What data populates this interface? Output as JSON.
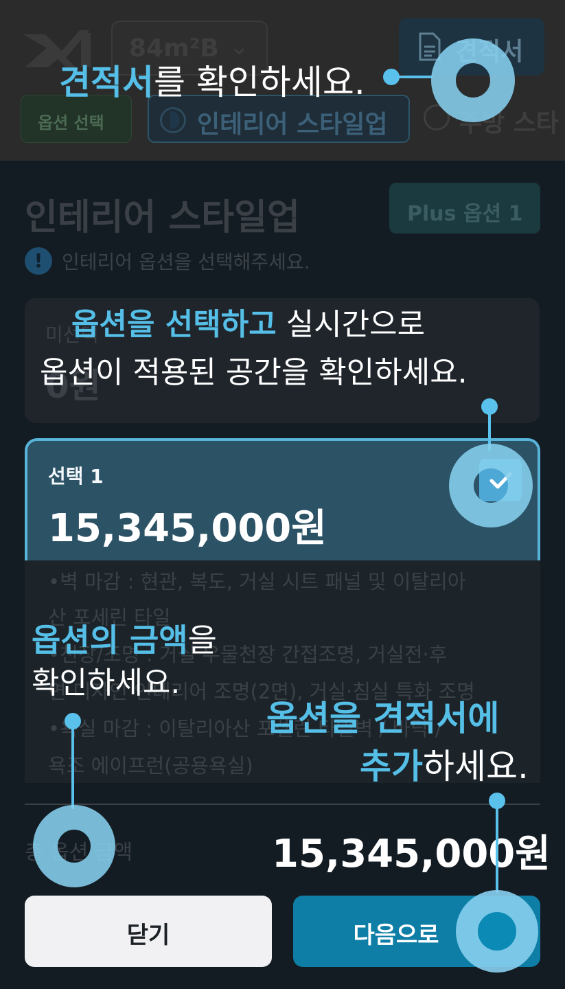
{
  "header": {
    "unit_selector": "84m²B",
    "quote_button": "견적서",
    "tabs": [
      "옵션 선택",
      "인테리어 스타일업",
      "주방 스타"
    ]
  },
  "sheet": {
    "title": "인테리어 스타일업",
    "plus_option_button": "Plus 옵션 1",
    "notice": "인테리어 옵션을 선택해주세요.",
    "options": [
      {
        "label": "미선택",
        "price": "0원",
        "selected": false
      },
      {
        "label": "선택 1",
        "price": "15,345,000원",
        "selected": true
      }
    ],
    "details": [
      "•벽 마감 : 현관, 복도, 거실 시트 패널 및 이탈리아",
      "산 포세린 타일",
      "•천장/조명 : 거실 우물천장 간접조명, 거실전·후",
      "면 디자인 인테리어 조명(2면), 거실·침실 특화 조명",
      "•욕실 마감 : 이탈리아산 포셀린 타일벽 / 바닥 /",
      "욕조 에이프런(공용욕실)"
    ],
    "total_label": "총 옵션 금액",
    "total_value": "15,345,000원",
    "close_button": "닫기",
    "next_button": "다음으로"
  },
  "coach": {
    "tip1": {
      "hl": "견적서",
      "text": "를 확인하세요."
    },
    "tip2": {
      "hl": "옵션을 선택하고",
      "text": " 실시간으로",
      "line2": "옵션이 적용된 공간을 확인하세요."
    },
    "tip3": {
      "hl": "옵션의 금액",
      "text": "을",
      "line2": "확인하세요."
    },
    "tip4": {
      "line1": "옵션을 견적서에",
      "hl": "추가",
      "text": "하세요."
    }
  },
  "colors": {
    "accent": "#55bfe8",
    "next_button": "#0e7ea6",
    "selected_card": "#2c5266"
  }
}
